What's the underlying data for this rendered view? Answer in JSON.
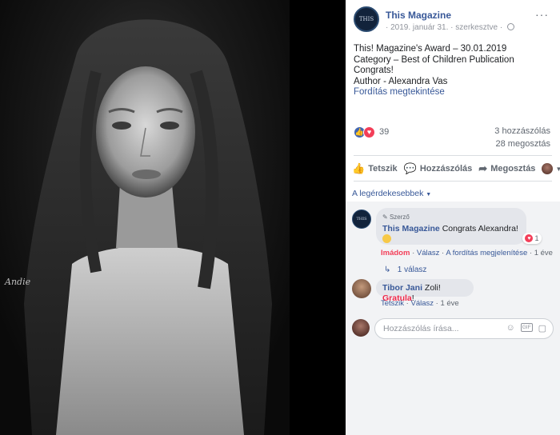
{
  "photo": {
    "watermark": "Andie"
  },
  "post": {
    "page_name": "This Magazine",
    "page_avatar_text": "THIS",
    "meta": "· 2019. január 31. · szerkesztve ·",
    "more": "···",
    "lines": [
      "This! Magazine's Award – 30.01.2019",
      "Category – Best of Children Publication",
      "Congrats!",
      "Author - Alexandra Vas"
    ],
    "translate_link": "Fordítás megtekintése"
  },
  "stats": {
    "reaction_count": "39",
    "comments": "3 hozzászólás",
    "shares": "28 megosztás"
  },
  "actions": {
    "like": "Tetszik",
    "comment": "Hozzászólás",
    "share": "Megosztás"
  },
  "sort_label": "A legérdekesebbek",
  "comments": [
    {
      "badge": "Szerző",
      "author": "This Magazine",
      "text": "Congrats Alexandra!",
      "reaction_count": "1",
      "action_loved": "Imádom",
      "action_reply": "Válasz",
      "action_translate": "A fordítás megjelenítése",
      "time": "1 éve",
      "replies_label": "1 válasz"
    },
    {
      "author": "Tibor Jani",
      "text_prefix": "Zoli!",
      "text_highlight": "Gratula",
      "text_suffix": "!",
      "action_like": "Tetszik",
      "action_reply": "Válasz",
      "time": "1 éve"
    }
  ],
  "write_placeholder": "Hozzászólás írása...",
  "colors": {
    "link": "#385898",
    "love": "#f33e58",
    "like": "#4267b2",
    "comments_bg": "#f2f3f5"
  }
}
